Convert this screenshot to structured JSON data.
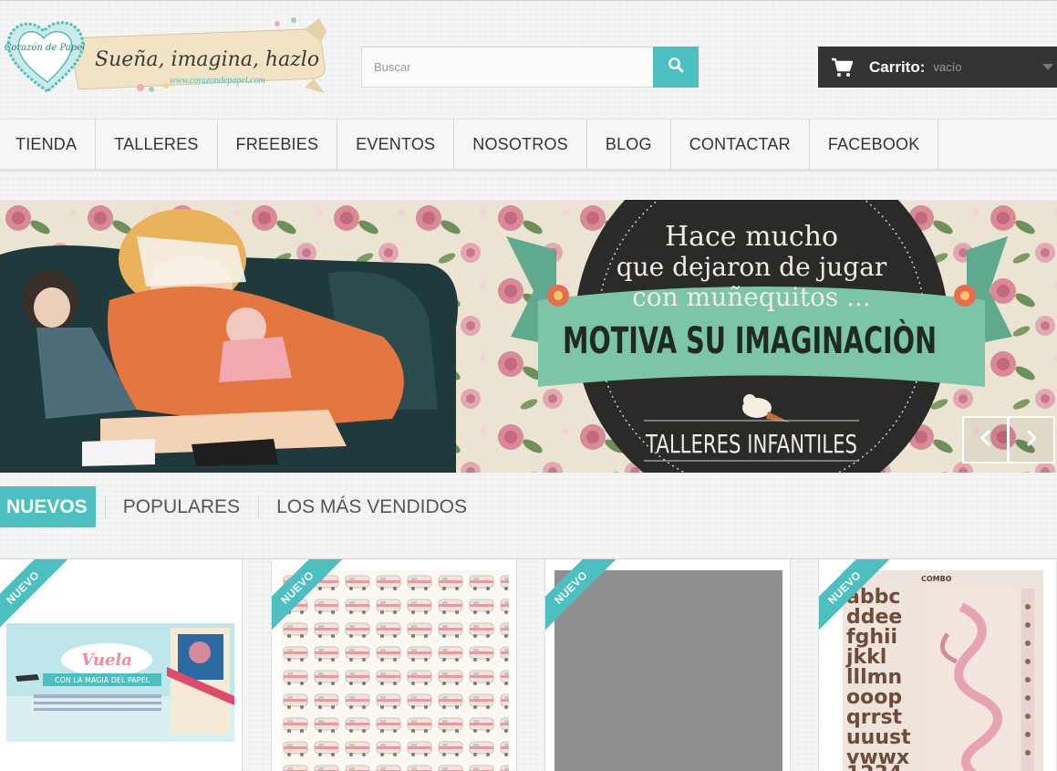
{
  "header": {
    "logo_tagline": "Sueña, imagina, hazlo",
    "logo_heart_text": "Corazón de Papel",
    "logo_url": "www.corazondepapel.com"
  },
  "search": {
    "placeholder": "Buscar",
    "icon": "search-icon"
  },
  "cart": {
    "title": "Carrito:",
    "status": "vacío",
    "icon": "cart-icon"
  },
  "nav": {
    "items": [
      "TIENDA",
      "TALLERES",
      "FREEBIES",
      "EVENTOS",
      "NOSOTROS",
      "BLOG",
      "CONTACTAR",
      "FACEBOOK"
    ]
  },
  "banner": {
    "line1": "Hace mucho",
    "line2": "que dejaron de jugar",
    "line3": "con muñequitos ...",
    "ribbon": "MOTIVA SU IMAGINACIÒN",
    "footer": "TALLERES INFANTILES"
  },
  "tabs": {
    "items": [
      "NUEVOS",
      "POPULARES",
      "LOS MÁS VENDIDOS"
    ]
  },
  "products": {
    "badge": "NUEVO",
    "p1_title": "Vuela",
    "p1_subtitle": "CON LA MAGIA DEL PAPEL",
    "p4_brand": "COMBO"
  },
  "colors": {
    "accent": "#4cbfc0",
    "dark": "#333333",
    "banner_dark": "#2a2a28",
    "ribbon_green": "#7cc5a8"
  }
}
